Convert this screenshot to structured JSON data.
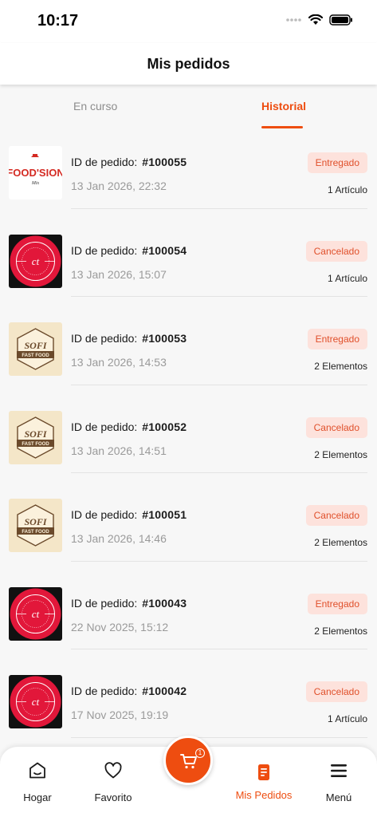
{
  "status_bar": {
    "time": "10:17"
  },
  "header": {
    "title": "Mis pedidos"
  },
  "tabs": [
    {
      "label": "En curso",
      "active": false
    },
    {
      "label": "Historial",
      "active": true
    }
  ],
  "orders": [
    {
      "id_label": "ID de pedido:",
      "id": "#100055",
      "date": "13 Jan 2026,  22:32",
      "status": "Entregado",
      "items": "1 Artículo",
      "logo": "foodsion",
      "logo_text": "FOOD'SION",
      "logo_sub": "Mix"
    },
    {
      "id_label": "ID de pedido:",
      "id": "#100054",
      "date": "13 Jan 2026,  15:07",
      "status": "Cancelado",
      "items": "1 Artículo",
      "logo": "ct",
      "logo_text": "ct"
    },
    {
      "id_label": "ID de pedido:",
      "id": "#100053",
      "date": "13 Jan 2026,  14:53",
      "status": "Entregado",
      "items": "2 Elementos",
      "logo": "sofi",
      "logo_text": "SOFI",
      "logo_sub": "FAST FOOD"
    },
    {
      "id_label": "ID de pedido:",
      "id": "#100052",
      "date": "13 Jan 2026,  14:51",
      "status": "Cancelado",
      "items": "2 Elementos",
      "logo": "sofi",
      "logo_text": "SOFI",
      "logo_sub": "FAST FOOD"
    },
    {
      "id_label": "ID de pedido:",
      "id": "#100051",
      "date": "13 Jan 2026,  14:46",
      "status": "Cancelado",
      "items": "2 Elementos",
      "logo": "sofi",
      "logo_text": "SOFI",
      "logo_sub": "FAST FOOD"
    },
    {
      "id_label": "ID de pedido:",
      "id": "#100043",
      "date": "22 Nov 2025,  15:12",
      "status": "Entregado",
      "items": "2 Elementos",
      "logo": "ct",
      "logo_text": "ct"
    },
    {
      "id_label": "ID de pedido:",
      "id": "#100042",
      "date": "17 Nov 2025,  19:19",
      "status": "Cancelado",
      "items": "1 Artículo",
      "logo": "ct",
      "logo_text": "ct"
    }
  ],
  "bottom_nav": {
    "items": [
      {
        "label": "Hogar",
        "icon": "home-icon"
      },
      {
        "label": "Favorito",
        "icon": "heart-icon"
      },
      {
        "label": "Mis Pedidos",
        "icon": "orders-icon",
        "active": true
      },
      {
        "label": "Menú",
        "icon": "menu-icon"
      }
    ],
    "cart_count": "1"
  },
  "colors": {
    "accent": "#ee4d10",
    "badge_bg": "#fde2dc",
    "ct_red": "#e2173a"
  }
}
